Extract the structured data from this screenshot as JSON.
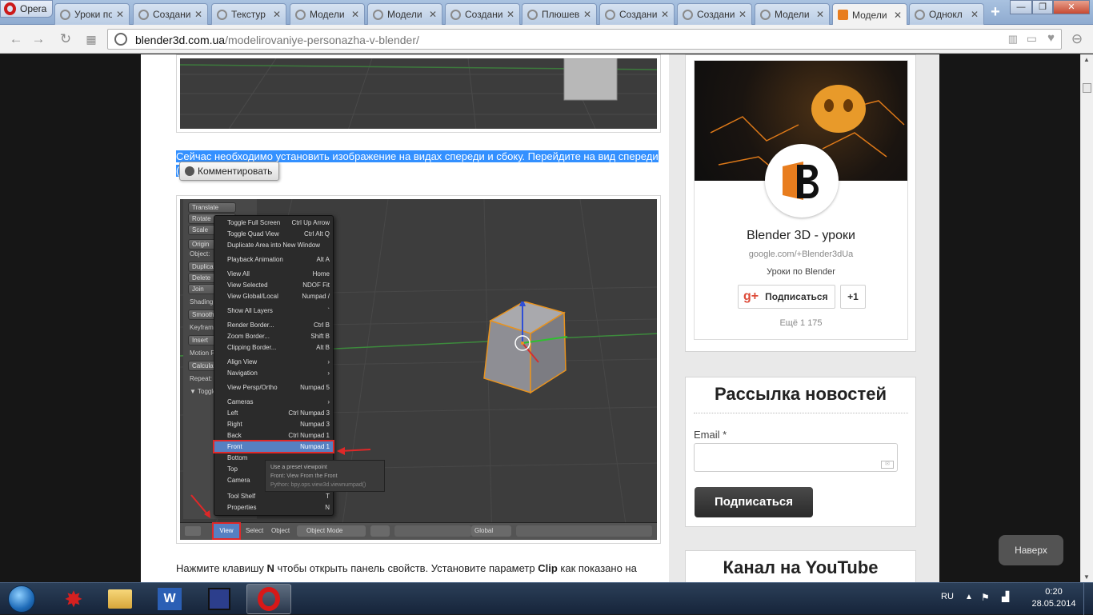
{
  "browser": {
    "opera_label": "Opera",
    "tabs": [
      {
        "title": "Уроки по"
      },
      {
        "title": "Создание"
      },
      {
        "title": "Текстур"
      },
      {
        "title": "Модели"
      },
      {
        "title": "Модели"
      },
      {
        "title": "Создание"
      },
      {
        "title": "Плюшев"
      },
      {
        "title": "Создание"
      },
      {
        "title": "Создание"
      },
      {
        "title": "Модели"
      },
      {
        "title": "Модели",
        "active": true
      },
      {
        "title": "Однокл"
      }
    ],
    "url_domain": "blender3d.com.ua",
    "url_path": "/modelirovaniye-personazha-v-blender/",
    "newtab_glyph": "+"
  },
  "article": {
    "selected_text": "Сейчас необходимо установить изображение на видах спереди и сбоку. Перейдите на вид спереди (",
    "comment_popup": "Комментировать",
    "paragraph_prefix": "Нажмите клавишу ",
    "paragraph_key": "N",
    "paragraph_mid": " чтобы открыть панель свойств. Установите параметр ",
    "paragraph_param": "Clip",
    "paragraph_suffix": " как показано на"
  },
  "blender": {
    "left_buttons": [
      {
        "label": "Translate"
      },
      {
        "label": "Rotate"
      },
      {
        "label": "Scale"
      },
      {
        "label": "Origin"
      },
      {
        "label": "Duplicate"
      },
      {
        "label": "Delete"
      },
      {
        "label": "Join"
      },
      {
        "label": "Smooth"
      },
      {
        "label": "Insert"
      },
      {
        "label": "Calculate"
      }
    ],
    "left_labels": [
      {
        "label": "Object:"
      },
      {
        "label": "Shading:"
      },
      {
        "label": "Keyframe"
      },
      {
        "label": "Motion Pa"
      },
      {
        "label": "Repeat:"
      },
      {
        "label": "▼ Toggle"
      }
    ],
    "menu": [
      {
        "label": "Toggle Full Screen",
        "key": "Ctrl Up Arrow"
      },
      {
        "label": "Toggle Quad View",
        "key": "Ctrl Alt Q"
      },
      {
        "label": "Duplicate Area into New Window",
        "key": ""
      },
      {
        "label": "Playback Animation",
        "key": "Alt A"
      },
      {
        "label": "View All",
        "key": "Home"
      },
      {
        "label": "View Selected",
        "key": "NDOF Fit"
      },
      {
        "label": "View Global/Local",
        "key": "Numpad /"
      },
      {
        "label": "Show All Layers",
        "key": "`"
      },
      {
        "label": "Render Border...",
        "key": "Ctrl B"
      },
      {
        "label": "Zoom Border...",
        "key": "Shift B"
      },
      {
        "label": "Clipping Border...",
        "key": "Alt B"
      },
      {
        "label": "Align View",
        "key": "›"
      },
      {
        "label": "Navigation",
        "key": "›"
      },
      {
        "label": "View Persp/Ortho",
        "key": "Numpad 5"
      },
      {
        "label": "Cameras",
        "key": "›"
      },
      {
        "label": "Left",
        "key": "Ctrl Numpad 3"
      },
      {
        "label": "Right",
        "key": "Numpad 3"
      },
      {
        "label": "Back",
        "key": "Ctrl Numpad 1"
      },
      {
        "label": "Front",
        "key": "Numpad 1",
        "highlight": true
      },
      {
        "label": "Bottom",
        "key": ""
      },
      {
        "label": "Top",
        "key": ""
      },
      {
        "label": "Camera",
        "key": ""
      },
      {
        "label": "Tool Shelf",
        "key": "T"
      },
      {
        "label": "Properties",
        "key": "N"
      }
    ],
    "tooltip": {
      "line1": "Use a preset viewpoint",
      "line2": "Front: View From the Front",
      "line3": "Python: bpy.ops.view3d.viewnumpad()"
    },
    "footer": {
      "view": "View",
      "select": "Select",
      "object": "Object",
      "mode": "Object Mode",
      "global": "Global"
    }
  },
  "sidebar": {
    "gplus": {
      "name": "Blender 3D - уроки",
      "url": "google.com/+Blender3dUa",
      "desc": "Уроки по Blender",
      "subscribe": "Подписаться",
      "plus_one": "+1",
      "more": "Ещё 1 175"
    },
    "newsletter": {
      "title": "Рассылка новостей",
      "email_label": "Email *",
      "email_value": "",
      "button": "Подписаться"
    },
    "youtube": {
      "title": "Канал на YouTube"
    },
    "back_to_top": "Наверх"
  },
  "taskbar": {
    "lang": "RU",
    "time": "0:20",
    "date": "28.05.2014"
  },
  "colors": {
    "selection": "#3390ff",
    "tab_active": "#f2f2f2",
    "accent_orange": "#e87d1e"
  }
}
